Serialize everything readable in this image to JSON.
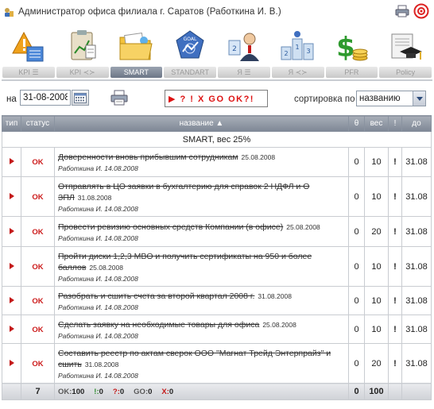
{
  "window": {
    "title": "Администратор офиса филиала г. Саратов (Работкина И. В.)"
  },
  "modules": [
    {
      "label": "KPI ☰",
      "icon": "kpi-warning-icon"
    },
    {
      "label": "KPI ≺≻",
      "icon": "kpi-clipboard-chart-icon"
    },
    {
      "label": "SMART",
      "icon": "smart-folder-icon",
      "active": true
    },
    {
      "label": "STANDART",
      "icon": "standart-goal-icon"
    },
    {
      "label": "Я ☰",
      "icon": "me-person-icon"
    },
    {
      "label": "Я ≺≻",
      "icon": "me-ranking-icon"
    },
    {
      "label": "PFR",
      "icon": "pfr-dollar-icon"
    },
    {
      "label": "Policy",
      "icon": "policy-graduation-icon"
    }
  ],
  "controls": {
    "date_label": "на",
    "date_value": "31-08-2008",
    "status_filter": "▶ ? ! X GO OK?!",
    "sort_label": "сортировка по",
    "sort_value": "названию"
  },
  "table": {
    "headers": {
      "type": "тип",
      "status": "статус",
      "name": "название ▲",
      "progress": "θ",
      "weight": "вес",
      "flag": "!",
      "due": "до"
    },
    "group": "SMART, вес 25%",
    "rows": [
      {
        "status": "OK",
        "title": "Доверенности вновь прибывшим сотрудникам",
        "date": "25.08.2008",
        "meta": "Работкина И. 14.08.2008",
        "progress": "0",
        "weight": "10",
        "flag": "!",
        "due": "31.08"
      },
      {
        "status": "OK",
        "title": "Отправлять в ЦО заявки в бухгалтерию для справок 2 НДФЛ и О ЗПЛ",
        "date": "31.08.2008",
        "meta": "Работкина И. 14.08.2008",
        "progress": "0",
        "weight": "10",
        "flag": "!",
        "due": "31.08"
      },
      {
        "status": "OK",
        "title": "Провести ревизию основных средств Компании (в офисе)",
        "date": "25.08.2008",
        "meta": "Работкина И. 14.08.2008",
        "progress": "0",
        "weight": "20",
        "flag": "!",
        "due": "31.08"
      },
      {
        "status": "OK",
        "title": "Пройти диски 1,2,3 MBO и получить сертификаты на 950 и более баллов",
        "date": "25.08.2008",
        "meta": "Работкина И. 14.08.2008",
        "progress": "0",
        "weight": "10",
        "flag": "!",
        "due": "31.08"
      },
      {
        "status": "OK",
        "title": "Разобрать и сшить счета за второй квартал 2008 г.",
        "date": "31.08.2008",
        "meta": "Работкина И. 14.08.2008",
        "progress": "0",
        "weight": "10",
        "flag": "!",
        "due": "31.08"
      },
      {
        "status": "OK",
        "title": "Сделать заявку на необходимые товары для офиса",
        "date": "25.08.2008",
        "meta": "Работкина И. 14.08.2008",
        "progress": "0",
        "weight": "10",
        "flag": "!",
        "due": "31.08"
      },
      {
        "status": "OK",
        "title": "Составить реестр по актам сверок ООО \"Магнат Трейд Энтерпрайз\" и сшить",
        "date": "31.08.2008",
        "meta": "Работкина И. 14.08.2008",
        "progress": "0",
        "weight": "20",
        "flag": "!",
        "due": "31.08"
      }
    ],
    "footer": {
      "count": "7",
      "ok_label": "OK:",
      "ok_value": "100",
      "warn_label": "!:",
      "warn_value": "0",
      "q_label": "?:",
      "q_value": "0",
      "go_label": "GO:",
      "go_value": "0",
      "x_label": "X:",
      "x_value": "0",
      "progress": "0",
      "weight": "100"
    }
  },
  "colors": {
    "accent_red": "#c41919",
    "header_gray": "#7e8795",
    "active_tab": "#6c7686"
  }
}
